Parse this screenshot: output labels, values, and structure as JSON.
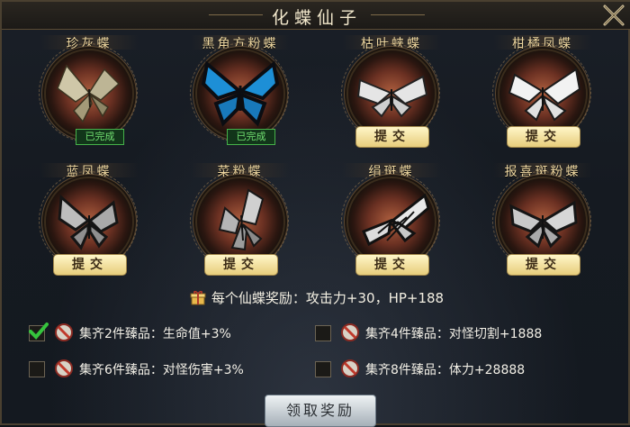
{
  "window": {
    "title": "化蝶仙子",
    "close_icon": "close-icon"
  },
  "butterflies": [
    {
      "name": "珍灰蝶",
      "status": "已完成",
      "action": ""
    },
    {
      "name": "黑角方粉蝶",
      "status": "已完成",
      "action": ""
    },
    {
      "name": "枯叶蛱蝶",
      "status": "",
      "action": "提交"
    },
    {
      "name": "柑橘凤蝶",
      "status": "",
      "action": "提交"
    },
    {
      "name": "蓝凤蝶",
      "status": "",
      "action": "提交"
    },
    {
      "name": "菜粉蝶",
      "status": "",
      "action": "提交"
    },
    {
      "name": "绢斑蝶",
      "status": "",
      "action": "提交"
    },
    {
      "name": "报喜斑粉蝶",
      "status": "",
      "action": "提交"
    }
  ],
  "reward": {
    "text": "每个仙蝶奖励：攻击力+30，HP+188",
    "icon": "gift-icon"
  },
  "bonuses": [
    {
      "text": "集齐2件臻品：生命值+3%",
      "checked": true
    },
    {
      "text": "集齐4件臻品：对怪切割+1888",
      "checked": false
    },
    {
      "text": "集齐6件臻品：对怪伤害+3%",
      "checked": false
    },
    {
      "text": "集齐8件臻品：体力+28888",
      "checked": false
    }
  ],
  "claim_button": "领取奖励",
  "colors": {
    "gold_text": "#f0d9a2",
    "done_green": "#46b24a",
    "button_gold": "#e7cd7c"
  }
}
